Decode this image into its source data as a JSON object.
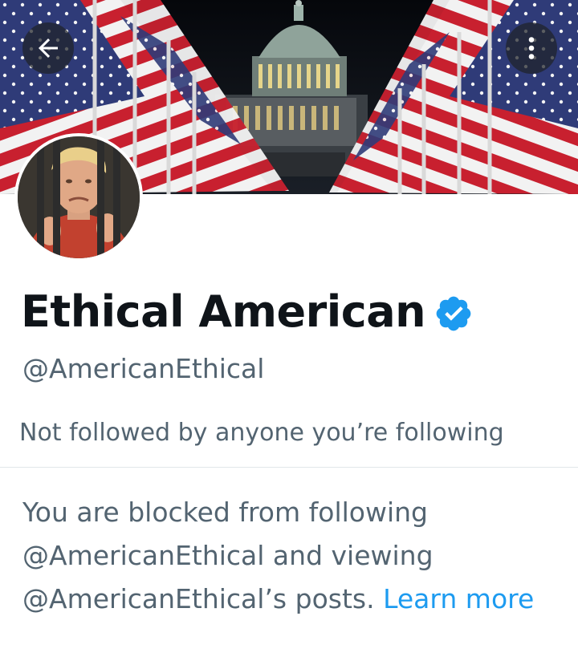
{
  "banner": {
    "description_icon": "capitol-flags-banner"
  },
  "toolbar": {
    "back_icon": "arrow-left-icon",
    "more_icon": "more-vertical-icon"
  },
  "profile": {
    "display_name": "Ethical American",
    "handle": "@AmericanEthical",
    "verified_icon": "verified-badge-icon",
    "followed_by": "Not followed by anyone you’re following"
  },
  "blocked_notice": {
    "text": "You are blocked from following @AmericanEthical and viewing @AmericanEthical’s posts.",
    "link_label": "Learn more"
  },
  "colors": {
    "accent": "#1d9bf0",
    "secondary_text": "#536471",
    "primary_text": "#0f1419"
  }
}
